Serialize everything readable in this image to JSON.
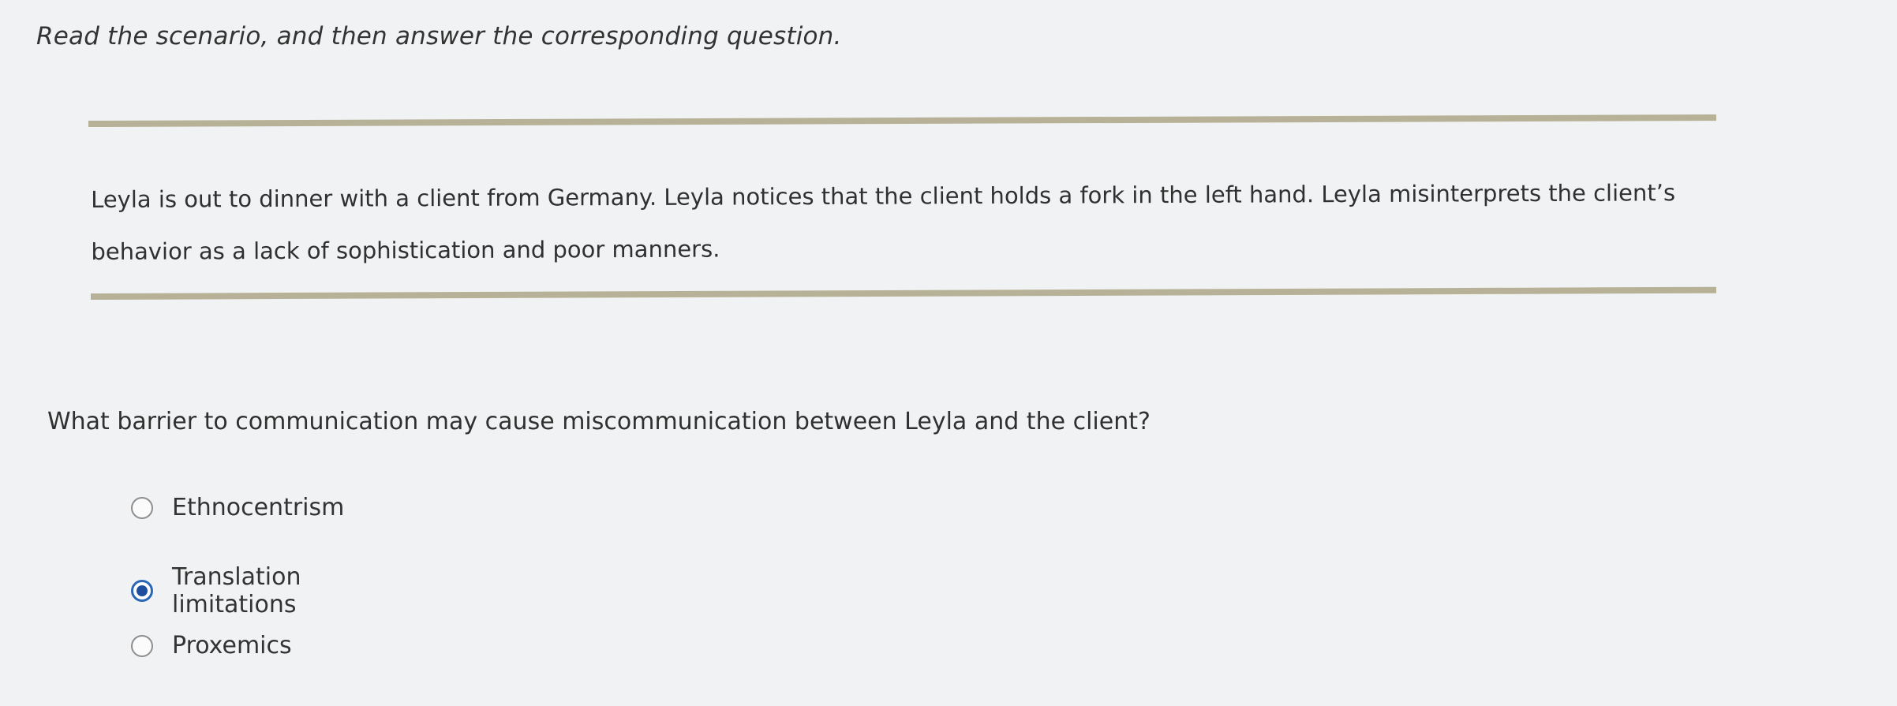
{
  "instruction": "Read the scenario, and then answer the corresponding question.",
  "scenario": "Leyla is out to dinner with a client from Germany. Leyla notices that the client holds a fork in the left hand. Leyla misinterprets the client’s behavior as a lack of sophistication and poor manners.",
  "question": "What barrier to communication may cause miscommunication between Leyla and the client?",
  "options": [
    {
      "label": "Ethnocentrism",
      "selected": false
    },
    {
      "label": "Translation limitations",
      "selected": true
    },
    {
      "label": "Proxemics",
      "selected": false
    }
  ],
  "colors": {
    "background": "#f1f2f3",
    "rule": "#b7b297",
    "radio_selected": "#2b67b8"
  }
}
